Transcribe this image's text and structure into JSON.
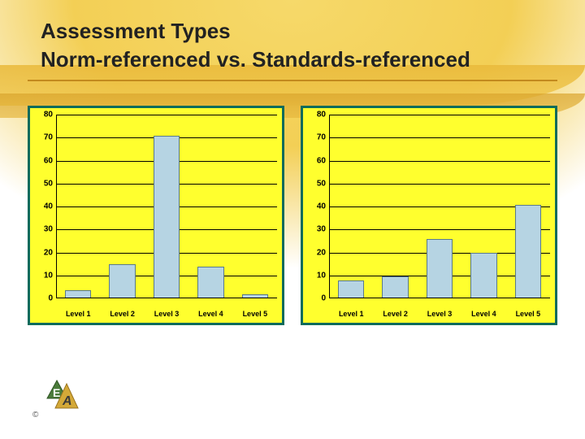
{
  "title": {
    "line1": "Assessment Types",
    "line2": "Norm-referenced   vs.   Standards-referenced"
  },
  "chart_data": [
    {
      "type": "bar",
      "title": "Norm-referenced",
      "categories": [
        "Level 1",
        "Level 2",
        "Level 3",
        "Level 4",
        "Level 5"
      ],
      "values": [
        3,
        14,
        70,
        13,
        1
      ],
      "ylim": [
        0,
        80
      ],
      "yticks": [
        0,
        10,
        20,
        30,
        40,
        50,
        60,
        70,
        80
      ]
    },
    {
      "type": "bar",
      "title": "Standards-referenced",
      "categories": [
        "Level 1",
        "Level 2",
        "Level 3",
        "Level 4",
        "Level 5"
      ],
      "values": [
        7,
        9,
        25,
        19,
        40
      ],
      "ylim": [
        0,
        80
      ],
      "yticks": [
        0,
        10,
        20,
        30,
        40,
        50,
        60,
        70,
        80
      ]
    }
  ],
  "copyright": "©"
}
